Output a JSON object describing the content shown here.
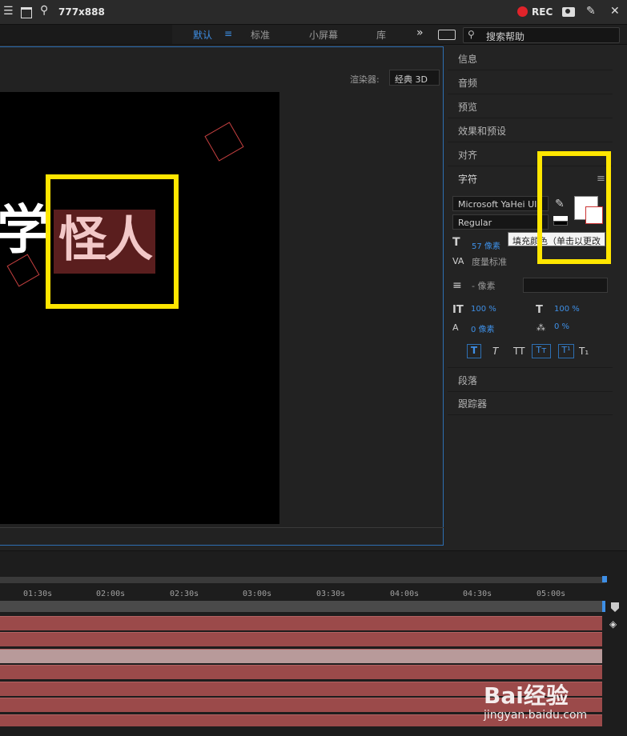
{
  "topbar": {
    "title": "777x888",
    "rec": "REC"
  },
  "workspace": {
    "tabs": [
      "默认",
      "标准",
      "小屏幕",
      "库"
    ],
    "more": "»",
    "search_placeholder": "搜索帮助"
  },
  "viewer": {
    "renderer_label": "渲染器:",
    "renderer_value": "经典 3D",
    "text_left": "学",
    "text_main": "怪人"
  },
  "panel": {
    "sections_top": [
      "信息",
      "音频",
      "预览",
      "效果和预设",
      "对齐"
    ],
    "character": {
      "title": "字符",
      "font": "Microsoft YaHei UI",
      "style": "Regular",
      "size": "57 像素",
      "kerning": "度量标准",
      "tooltip": "填充颜色（单击以更改",
      "leading": "- 像素",
      "vscale": "100 %",
      "hscale": "100 %",
      "baseline": "0 像素",
      "tsume": "0 %",
      "style_buttons": [
        "T",
        "T",
        "TT",
        "Tт",
        "T¹",
        "T₁"
      ]
    },
    "sections_bottom": [
      "段落",
      "跟踪器"
    ]
  },
  "timeline": {
    "ticks": [
      "01:30s",
      "02:00s",
      "02:30s",
      "03:00s",
      "03:30s",
      "04:00s",
      "04:30s",
      "05:00s"
    ]
  },
  "watermark": {
    "brand": "Bai经验",
    "url": "jingyan.baidu.com"
  }
}
